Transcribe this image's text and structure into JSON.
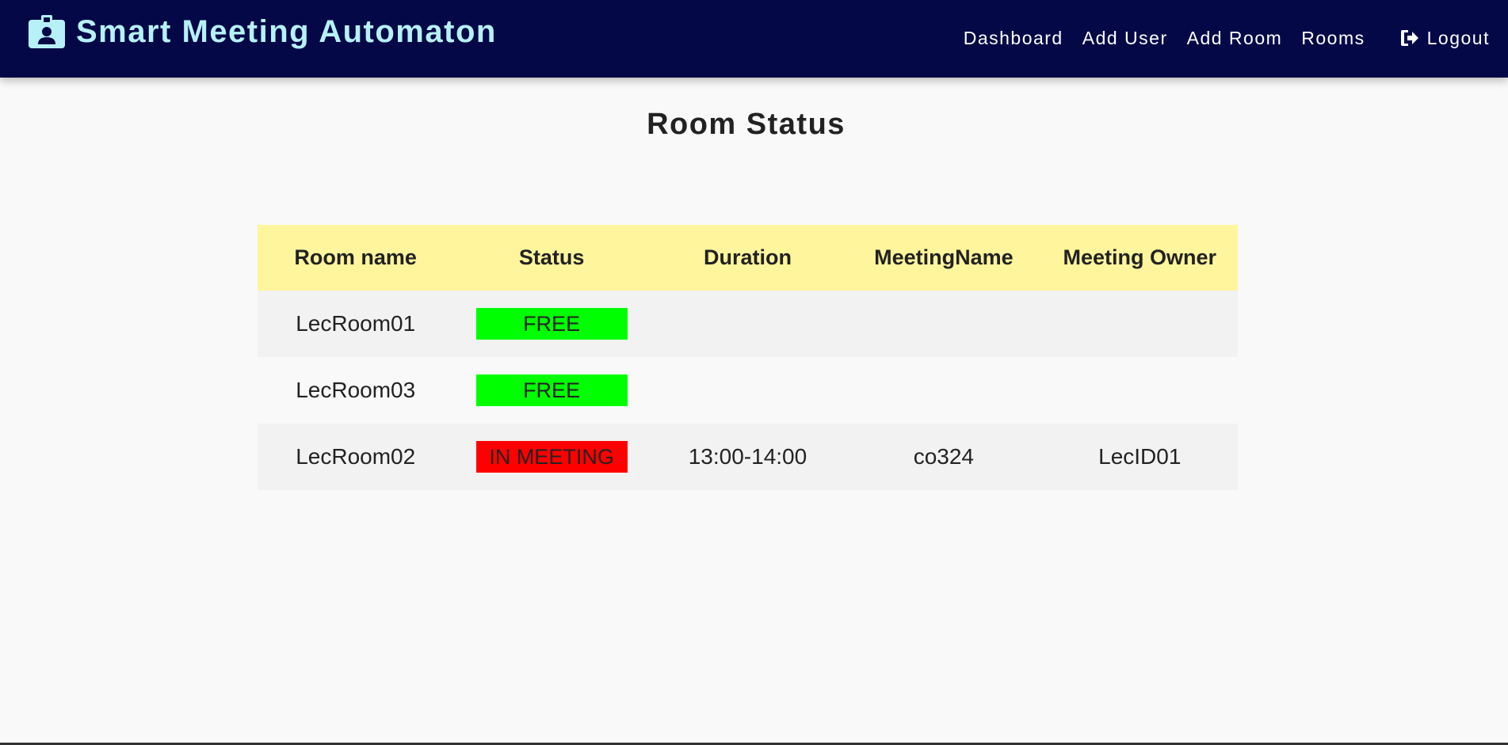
{
  "app": {
    "title": "Smart Meeting Automaton",
    "brand_icon": "id-badge-icon",
    "brand_color": "#b6f1f7",
    "navbar_color": "#050847"
  },
  "nav": {
    "dashboard": "Dashboard",
    "add_user": "Add User",
    "add_room": "Add Room",
    "rooms": "Rooms",
    "logout": "Logout",
    "logout_icon": "sign-out-icon"
  },
  "page": {
    "title": "Room Status"
  },
  "table": {
    "header_color": "#fff59d",
    "columns": [
      "Room name",
      "Status",
      "Duration",
      "MeetingName",
      "Meeting Owner"
    ],
    "rows": [
      {
        "room": "LecRoom01",
        "status": "FREE",
        "status_color": "#00ff00",
        "duration": "",
        "meeting_name": "",
        "owner": ""
      },
      {
        "room": "LecRoom03",
        "status": "FREE",
        "status_color": "#00ff00",
        "duration": "",
        "meeting_name": "",
        "owner": ""
      },
      {
        "room": "LecRoom02",
        "status": "IN MEETING",
        "status_color": "#ff0000",
        "duration": "13:00-14:00",
        "meeting_name": "co324",
        "owner": "LecID01"
      }
    ]
  }
}
